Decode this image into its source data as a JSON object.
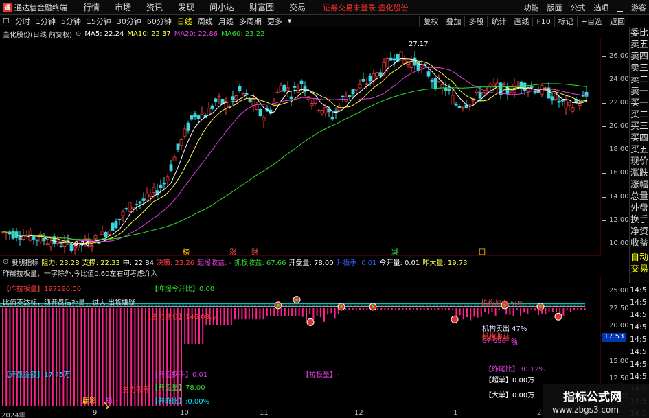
{
  "titlebar": {
    "app_title": "通达信金融终端",
    "menu": [
      "行情",
      "市场",
      "资讯",
      "发现",
      "问小达",
      "财富圈",
      "交易"
    ],
    "notice": "证券交易未登录  壶化股份",
    "right_menu": [
      "功能",
      "版面",
      "公式",
      "选项"
    ],
    "guest": "游客"
  },
  "toolbar": {
    "periods": [
      "分时",
      "1分钟",
      "5分钟",
      "15分钟",
      "30分钟",
      "60分钟",
      "日线",
      "周线",
      "月线",
      "多周期",
      "更多"
    ],
    "active": "日线",
    "right_buttons": [
      "复权",
      "叠加",
      "多股",
      "统计",
      "画线",
      "F10",
      "标记",
      "+自选",
      "返回"
    ]
  },
  "info": {
    "stock": "壶化股份(日线 前复权)",
    "ma5": "MA5: 22.24",
    "ma10": "MA10: 22.37",
    "ma20": "MA20: 22.86",
    "ma60": "MA60: 23.22"
  },
  "colors": {
    "up": "#ff3b3b",
    "down": "#39d7e0",
    "ma5": "#ffffff",
    "ma10": "#ffff4a",
    "ma20": "#e040e0",
    "ma60": "#30e030",
    "pink": "#ff1f8e"
  },
  "price_axis": [
    "26.00",
    "24.00",
    "22.00",
    "20.00",
    "18.00",
    "16.00",
    "14.00",
    "12.00",
    "10.00"
  ],
  "price_annotations": {
    "high": "27.17",
    "low": "9.76"
  },
  "event_markers": [
    "榜",
    "涨",
    "财",
    "减",
    "回"
  ],
  "sidebar": [
    "委比",
    "卖五",
    "卖四",
    "卖三",
    "卖二",
    "卖一",
    "买一",
    "买二",
    "买三",
    "买四",
    "买五",
    "现价",
    "涨跌",
    "涨幅",
    "总量",
    "外盘",
    "换手",
    "净资",
    "收益",
    "",
    "自动",
    "交易"
  ],
  "indicator": {
    "name": "股朋指标",
    "resistance": "阻力: 23.28",
    "support": "支撑: 22.33",
    "mid": "中: 22.84",
    "decision": "决策: 23.26",
    "qibao": "起爆收益: -",
    "zhuaban": "抓板收益: 67.66",
    "kaipan": "开盘量: 78.00",
    "shengban": "升板手: 0.01",
    "jinkai": "今开量: 0.01",
    "zuoda": "昨大量: 19.73",
    "line2": "昨晨拉板量，一字除外,今比值0.60左右可考虑介入",
    "axis": [
      "25.00",
      "22.50",
      "20.00",
      "17.53",
      "15.00",
      "12.50",
      "10.00"
    ],
    "current_box": "17.53",
    "labels": {
      "zuolaban": "【昨拉板量】197290.00",
      "zuobao": "【昨爆今开比】0.00",
      "bizhi": "比值不达标，须开盘后补量，过大 出货嫌疑",
      "zhuli": "【主力建仓】146.08万",
      "jigou_jian": "机构加仓 50%",
      "jigou_mai": "机构卖出 47%",
      "jigou_shou": "机构收益",
      "pct1": "67.656",
      "pct_sign": "%",
      "qibao2": "起爆收益",
      "pct_sign2": "%",
      "kaipan_jine": "【开盘金额】17.45万",
      "kaipan_huanshou": "【开盘换手】0.01",
      "laban": "【拉板量】-",
      "kaipanliang": "【开盘量】78.00",
      "zhuli_xishou": "主力吸筹",
      "kaizuo": "【开昨比】:0.00%",
      "yaying": "压影",
      "zhua": "抓",
      "zuowei": "【昨尾比】30.12%",
      "chaodan": "【超单】0.00万",
      "dadan": "【大单】0.00万"
    }
  },
  "date_axis": [
    "2024年",
    "9",
    "10",
    "11",
    "12",
    "1",
    "2"
  ],
  "watermark": {
    "title": "指标公式网",
    "url": "www.zbgs3.com"
  }
}
